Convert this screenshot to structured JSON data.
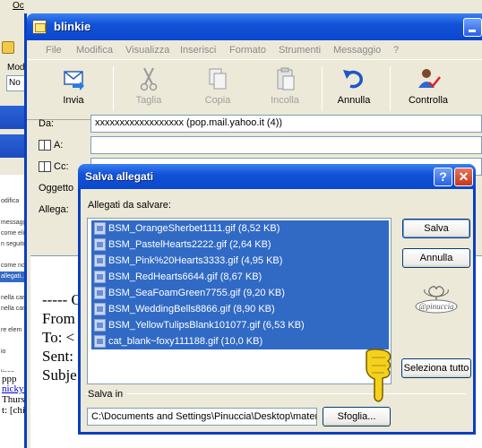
{
  "background": {
    "top_label": "Oc",
    "left_labels": [
      "Mod",
      "No"
    ],
    "panel_items": [
      "",
      "",
      "odifica",
      "",
      "messaggi",
      "come elim",
      "n seguito",
      "",
      "come nomi",
      "allegati...",
      "",
      "nella car",
      "nella cart",
      "",
      "re elem",
      "",
      "io",
      "",
      "linea"
    ],
    "body_fragments": [
      "ppp",
      "nickyn",
      "Thursd",
      "t: [chi"
    ]
  },
  "window": {
    "title": "blinkie",
    "menu": [
      "File",
      "Modifica",
      "Visualizza",
      "Inserisci",
      "Formato",
      "Strumenti",
      "Messaggio",
      "?"
    ],
    "toolbar": [
      {
        "label": "Invia",
        "enabled": true,
        "icon": "send-icon"
      },
      {
        "label": "Taglia",
        "enabled": false,
        "icon": "scissors-icon"
      },
      {
        "label": "Copia",
        "enabled": false,
        "icon": "copy-icon"
      },
      {
        "label": "Incolla",
        "enabled": false,
        "icon": "paste-icon"
      },
      {
        "label": "Annulla",
        "enabled": true,
        "icon": "undo-icon"
      },
      {
        "label": "Controlla",
        "enabled": true,
        "icon": "check-names-icon"
      }
    ],
    "fields": {
      "from_label": "Da:",
      "from_value": "xxxxxxxxxxxxxxxxxx  (pop.mail.yahoo.it (4))",
      "to_label": "A:",
      "cc_label": "Cc:",
      "subject_label": "Oggetto",
      "attach_label": "Allega:"
    },
    "body_lines": [
      "----- O",
      "From",
      "To: <",
      "Sent:",
      "Subje"
    ]
  },
  "dialog": {
    "title": "Salva allegati",
    "help_label": "?",
    "close_label": "✕",
    "list_label": "Allegati da salvare:",
    "attachments": [
      "BSM_OrangeSherbet1111.gif (8,52 KB)",
      "BSM_PastelHearts2222.gif (2,64 KB)",
      "BSM_Pink%20Hearts3333.gif (4,95 KB)",
      "BSM_RedHearts6644.gif (8,67 KB)",
      "BSM_SeaFoamGreen7755.gif (9,20 KB)",
      "BSM_WeddingBells8866.gif (8,90 KB)",
      "BSM_YellowTulipsBlank101077.gif (6,53 KB)",
      "cat_blank~foxy111188.gif (10,0 KB)"
    ],
    "save_button": "Salva",
    "cancel_button": "Annulla",
    "select_all_button": "Seleziona tutto",
    "save_in_label": "Salva in",
    "save_path": "C:\\Documents and Settings\\Pinuccia\\Desktop\\mater",
    "browse_button": "Sfoglia...",
    "stamp_text": "@pinuccia"
  },
  "colors": {
    "xp_blue": "#0a47cf",
    "selection": "#316ac5",
    "dialog_bg": "#ece9d8"
  }
}
